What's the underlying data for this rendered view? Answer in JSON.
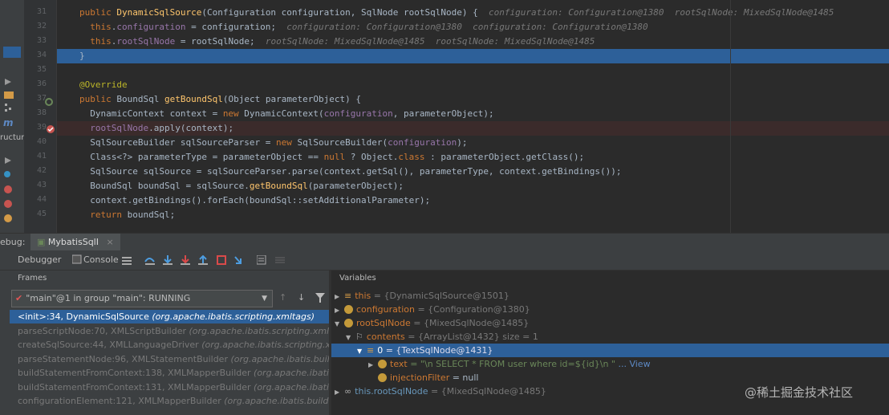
{
  "left_strip": {
    "structure_label": "ructur"
  },
  "code": {
    "lines": [
      {
        "num": "31",
        "text": "public DynamicSqlSource(Configuration configuration, SqlNode rootSqlNode) {",
        "hint": "  configuration: Configuration@1380  rootSqlNode: MixedSqlNode@1485"
      },
      {
        "num": "32",
        "text": "  this.configuration = configuration;",
        "hint": "  configuration: Configuration@1380  configuration: Configuration@1380"
      },
      {
        "num": "33",
        "text": "  this.rootSqlNode = rootSqlNode;",
        "hint": "  rootSqlNode: MixedSqlNode@1485  rootSqlNode: MixedSqlNode@1485"
      },
      {
        "num": "34",
        "text": "}",
        "hint": ""
      },
      {
        "num": "35",
        "text": "",
        "hint": ""
      },
      {
        "num": "36",
        "text": "@Override",
        "hint": ""
      },
      {
        "num": "37",
        "text": "public BoundSql getBoundSql(Object parameterObject) {",
        "hint": ""
      },
      {
        "num": "38",
        "text": "  DynamicContext context = new DynamicContext(configuration, parameterObject);",
        "hint": ""
      },
      {
        "num": "39",
        "text": "  rootSqlNode.apply(context);",
        "hint": ""
      },
      {
        "num": "40",
        "text": "  SqlSourceBuilder sqlSourceParser = new SqlSourceBuilder(configuration);",
        "hint": ""
      },
      {
        "num": "41",
        "text": "  Class<?> parameterType = parameterObject == null ? Object.class : parameterObject.getClass();",
        "hint": ""
      },
      {
        "num": "42",
        "text": "  SqlSource sqlSource = sqlSourceParser.parse(context.getSql(), parameterType, context.getBindings());",
        "hint": ""
      },
      {
        "num": "43",
        "text": "  BoundSql boundSql = sqlSource.getBoundSql(parameterObject);",
        "hint": ""
      },
      {
        "num": "44",
        "text": "  context.getBindings().forEach(boundSql::setAdditionalParameter);",
        "hint": ""
      },
      {
        "num": "45",
        "text": "  return boundSql;",
        "hint": ""
      }
    ]
  },
  "debug_bar": {
    "label": "ebug:",
    "tab_title": "MybatisSqlI",
    "close": "×"
  },
  "toolbar": {
    "debugger_tab": "Debugger",
    "console_tab": "Console"
  },
  "frames": {
    "title": "Frames",
    "thread_select": "\"main\"@1 in group \"main\": RUNNING",
    "items": [
      {
        "method": "<init>:34, DynamicSqlSource",
        "pkg": "(org.apache.ibatis.scripting.xmltags)"
      },
      {
        "method": "parseScriptNode:70, XMLScriptBuilder",
        "pkg": "(org.apache.ibatis.scripting.xmltags)"
      },
      {
        "method": "createSqlSource:44, XMLLanguageDriver",
        "pkg": "(org.apache.ibatis.scripting.xmltags)"
      },
      {
        "method": "parseStatementNode:96, XMLStatementBuilder",
        "pkg": "(org.apache.ibatis.builder.xml)"
      },
      {
        "method": "buildStatementFromContext:138, XMLMapperBuilder",
        "pkg": "(org.apache.ibatis.builder.xml)"
      },
      {
        "method": "buildStatementFromContext:131, XMLMapperBuilder",
        "pkg": "(org.apache.ibatis.builder.xml)"
      },
      {
        "method": "configurationElement:121, XMLMapperBuilder",
        "pkg": "(org.apache.ibatis.builder.xml)"
      }
    ]
  },
  "variables": {
    "title": "Variables",
    "rows": [
      {
        "name": "this",
        "value": "= {DynamicSqlSource@1501}"
      },
      {
        "name": "configuration",
        "value": "= {Configuration@1380}"
      },
      {
        "name": "rootSqlNode",
        "value": "= {MixedSqlNode@1485}"
      },
      {
        "name": "contents",
        "value": "= {ArrayList@1432}  size = 1"
      },
      {
        "name": "0",
        "value": "= {TextSqlNode@1431}"
      },
      {
        "name": "text",
        "value": "= \"\\n        SELECT * FROM user where id=${id}\\n    \"",
        "link": "... View"
      },
      {
        "name": "injectionFilter",
        "value": "= null"
      },
      {
        "name": "this.rootSqlNode",
        "value": "= {MixedSqlNode@1485}"
      }
    ]
  },
  "watermark": "@稀土掘金技术社区",
  "colors": {
    "accent": "#2d6099",
    "keyword": "#cc7832",
    "function": "#ffc66d",
    "field": "#9876aa"
  }
}
